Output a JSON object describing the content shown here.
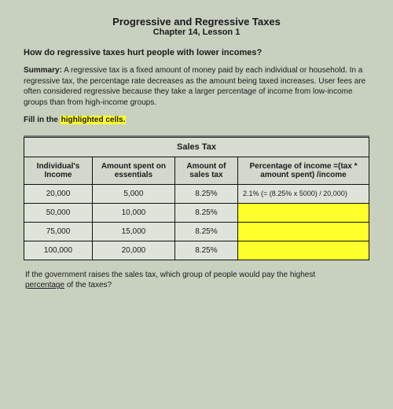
{
  "header": {
    "title_main": "Progressive and Regressive Taxes",
    "title_sub": "Chapter 14, Lesson 1"
  },
  "question_heading": "How do regressive taxes hurt people with lower incomes?",
  "summary": {
    "label": "Summary:",
    "text": " A regressive tax is a fixed amount of money paid by each individual or household. In a regressive tax, the percentage rate decreases as the amount being taxed increases. User fees are often considered regressive because they take a larger percentage of income from low-income groups than from high-income groups."
  },
  "fill_in": {
    "prefix": "Fill in the ",
    "highlighted": "highlighted cells.",
    "suffix": ""
  },
  "table": {
    "title": "Sales Tax",
    "headers": {
      "h1": "Individual's Income",
      "h2": "Amount spent on essentials",
      "h3": "Amount of sales tax",
      "h4": "Percentage of income =(tax * amount spent) /income"
    },
    "rows": [
      {
        "income": "20,000",
        "spent": "5,000",
        "tax": "8.25%",
        "pct": "2.1% (= (8.25% x 5000) / 20,000)",
        "hl": false
      },
      {
        "income": "50,000",
        "spent": "10,000",
        "tax": "8.25%",
        "pct": "",
        "hl": true
      },
      {
        "income": "75,000",
        "spent": "15,000",
        "tax": "8.25%",
        "pct": "",
        "hl": true
      },
      {
        "income": "100,000",
        "spent": "20,000",
        "tax": "8.25%",
        "pct": "",
        "hl": true
      }
    ]
  },
  "footer_q": {
    "line1": "If the government raises the sales tax, which group of people would pay the highest",
    "line2_prefix": "percentage",
    "line2_suffix": " of the taxes?"
  }
}
